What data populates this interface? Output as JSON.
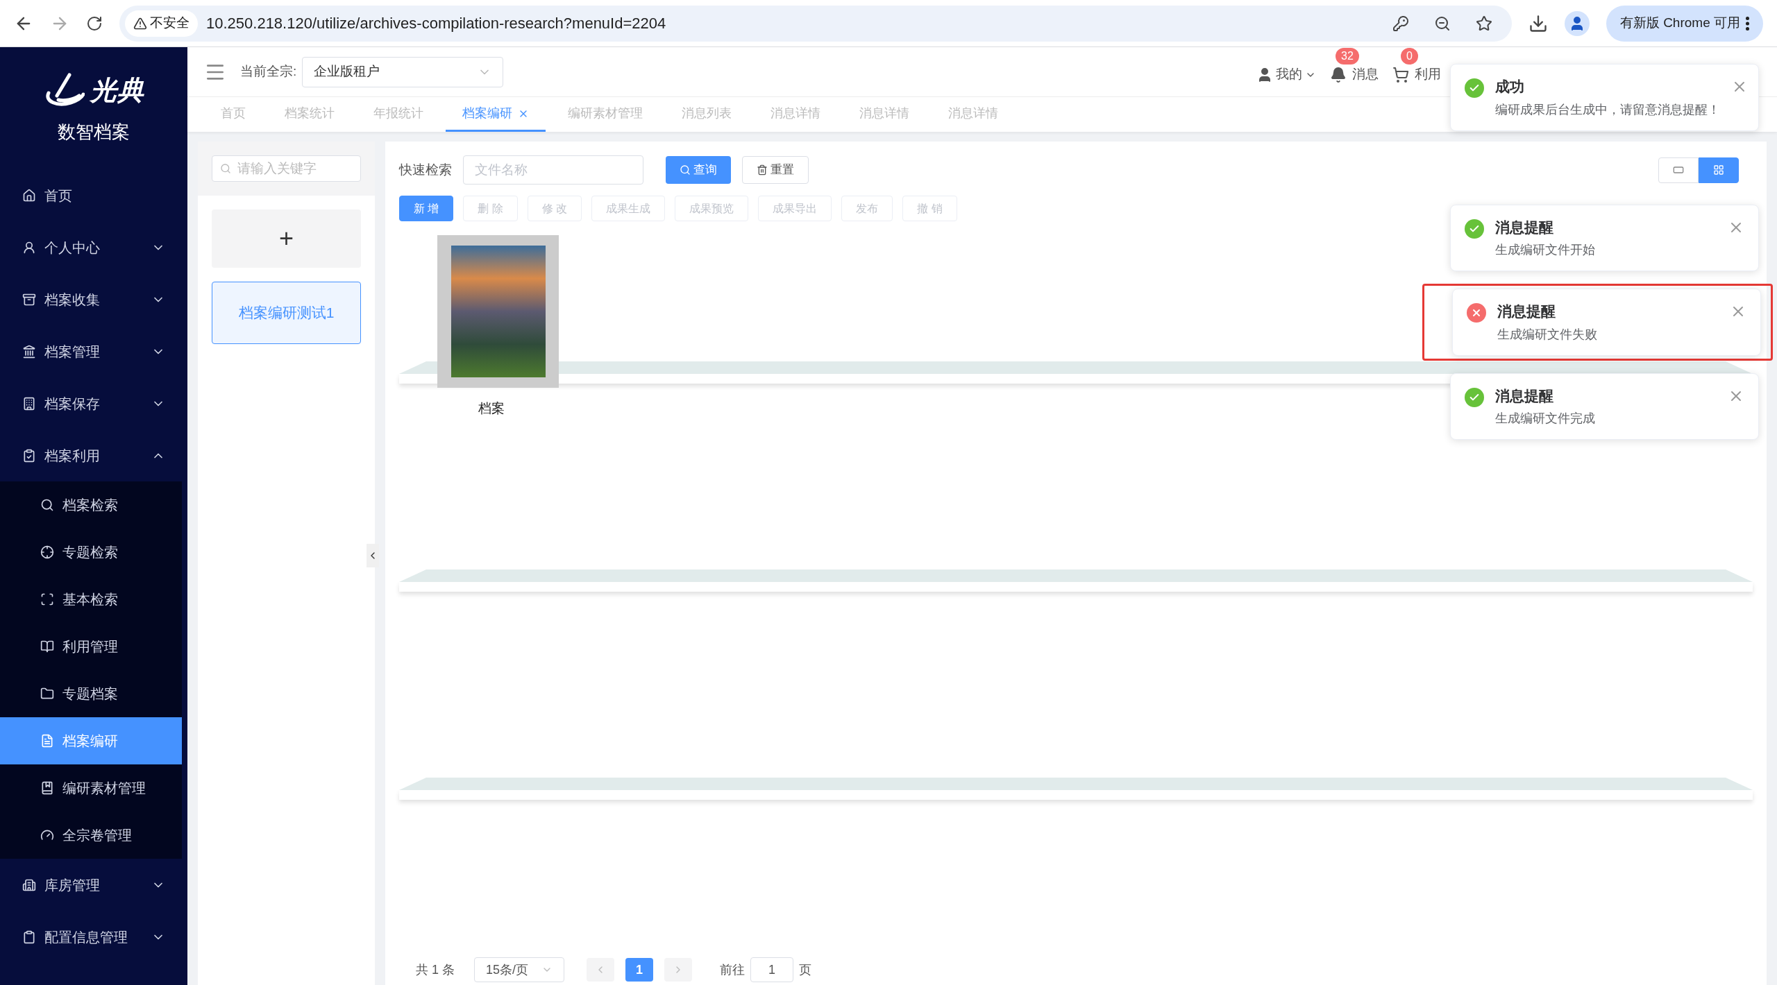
{
  "browser": {
    "security": "不安全",
    "url": "10.250.218.120/utilize/archives-compilation-research?menuId=2204",
    "update_button": "有新版 Chrome 可用"
  },
  "brand": {
    "logo_text": "光典",
    "app_name": "数智档案"
  },
  "sidebar": {
    "items": [
      {
        "label": "首页",
        "kind": "link"
      },
      {
        "label": "个人中心",
        "kind": "group",
        "expanded": false
      },
      {
        "label": "档案收集",
        "kind": "group",
        "expanded": false
      },
      {
        "label": "档案管理",
        "kind": "group",
        "expanded": false
      },
      {
        "label": "档案保存",
        "kind": "group",
        "expanded": false
      },
      {
        "label": "档案利用",
        "kind": "group",
        "expanded": true,
        "children": [
          {
            "label": "档案检索",
            "selected": false
          },
          {
            "label": "专题检索",
            "selected": false
          },
          {
            "label": "基本检索",
            "selected": false
          },
          {
            "label": "利用管理",
            "selected": false
          },
          {
            "label": "专题档案",
            "selected": false
          },
          {
            "label": "档案编研",
            "selected": true
          },
          {
            "label": "编研素材管理",
            "selected": false
          },
          {
            "label": "全宗卷管理",
            "selected": false
          }
        ]
      },
      {
        "label": "库房管理",
        "kind": "group",
        "expanded": false
      },
      {
        "label": "配置信息管理",
        "kind": "group",
        "expanded": false
      }
    ]
  },
  "header": {
    "current_fonds_label": "当前全宗:",
    "current_fonds": "企业版租户",
    "user": "我的",
    "messages": {
      "label": "消息",
      "badge": "32"
    },
    "cart": {
      "label": "利用",
      "badge": "0"
    }
  },
  "tabs": [
    {
      "label": "首页",
      "selected": false
    },
    {
      "label": "档案统计",
      "selected": false
    },
    {
      "label": "年报统计",
      "selected": false
    },
    {
      "label": "档案编研",
      "selected": true
    },
    {
      "label": "编研素材管理",
      "selected": false
    },
    {
      "label": "消息列表",
      "selected": false
    },
    {
      "label": "消息详情",
      "selected": false
    },
    {
      "label": "消息详情",
      "selected": false
    },
    {
      "label": "消息详情",
      "selected": false
    }
  ],
  "left_panel": {
    "search_placeholder": "请输入关键字",
    "add_button": "+",
    "items": [
      {
        "label": "档案编研测试1",
        "selected": true
      }
    ]
  },
  "main": {
    "quick_search_label": "快速检索",
    "search_placeholder": "文件名称",
    "query_button": "查询",
    "reset_button": "重置",
    "view_modes": [
      {
        "selected": false
      },
      {
        "selected": true
      }
    ],
    "actions": [
      {
        "label": "新 增",
        "disabled": false
      },
      {
        "label": "删 除",
        "disabled": true
      },
      {
        "label": "修 改",
        "disabled": true
      },
      {
        "label": "成果生成",
        "disabled": true
      },
      {
        "label": "成果预览",
        "disabled": true
      },
      {
        "label": "成果导出",
        "disabled": true
      },
      {
        "label": "发布",
        "disabled": true
      },
      {
        "label": "撤 销",
        "disabled": true
      }
    ],
    "files": [
      {
        "name": "档案"
      }
    ],
    "pagination": {
      "total": "共 1 条",
      "page_size": "15条/页",
      "pages": [
        {
          "label": "1",
          "selected": true
        }
      ],
      "goto_label": "前往",
      "goto_value": "1",
      "page_suffix": "页"
    }
  },
  "notifications": [
    {
      "title": "成功",
      "message": "编研成果后台生成中，请留意消息提醒！",
      "kind": "success",
      "highlighted": false
    },
    {
      "title": "消息提醒",
      "message": "生成编研文件开始",
      "kind": "success",
      "highlighted": false
    },
    {
      "title": "消息提醒",
      "message": "生成编研文件失败",
      "kind": "error",
      "highlighted": true
    },
    {
      "title": "消息提醒",
      "message": "生成编研文件完成",
      "kind": "success",
      "highlighted": false
    }
  ]
}
